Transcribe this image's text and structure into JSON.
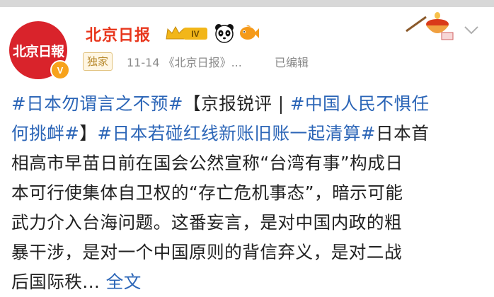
{
  "account": {
    "avatar_text": "北京日報",
    "verified_badge": "V",
    "name": "北京日报",
    "level_badge": "IV",
    "exclusive_label": "独家",
    "meta": "11-14 《北京日报》...",
    "edited_label": "已编辑"
  },
  "icons": {
    "crown": "crown-level-badge-icon",
    "panda": "panda-emoji-icon",
    "fish": "fish-emoji-icon",
    "decor": "hotpot-sticker-icon",
    "more": "chevron-down-icon"
  },
  "colors": {
    "name": "#e8361c",
    "tag": "#2b65b7",
    "avatar": "#d9232b"
  },
  "post": {
    "l1_tag1": "#日本勿谓言之不预#",
    "l1_text": "【京报锐评 | ",
    "l1_tag2": "#中国人民不惧任",
    "l2_tag2": "何挑衅#",
    "l2_text": "】",
    "l2_tag3": "#日本若碰红线新账旧账一起清算#",
    "l2_text2": "日本首",
    "l3": "相高市早苗日前在国会公然宣称“台湾有事”构成日",
    "l4": "本可行使集体自卫权的“存亡危机事态”，暗示可能",
    "l5": "武力介入台海问题。这番妄言，是对中国内政的粗",
    "l6": "暴干涉，是对一个中国原则的背信弃义，是对二战",
    "l7": "后国际秩... ",
    "more_label": "全文"
  }
}
